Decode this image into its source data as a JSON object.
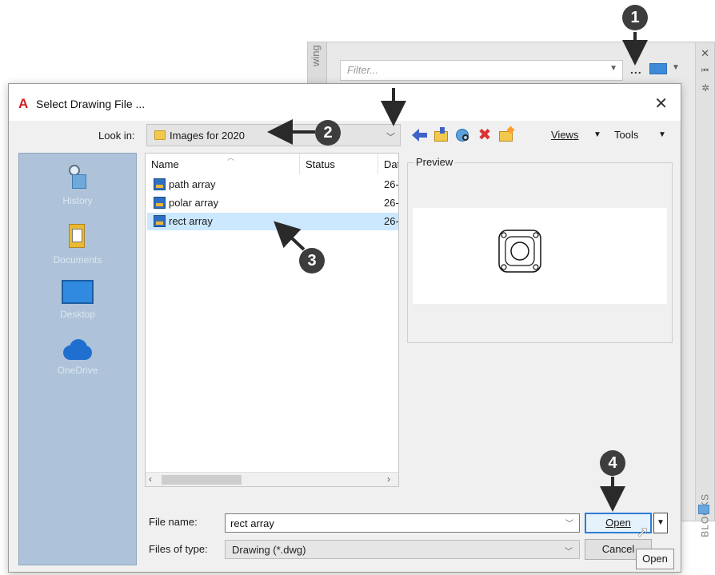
{
  "background_palette": {
    "side_label": "wing",
    "filter_placeholder": "Filter...",
    "ellipsis": "...",
    "blocks_label": "BLOCKS"
  },
  "dialog": {
    "title": "Select Drawing File ...",
    "close": "✕",
    "look_in_label": "Look in:",
    "look_in_value": "Images for 2020",
    "toolbar": {
      "views": "Views",
      "tools": "Tools"
    },
    "places": [
      {
        "label": "History",
        "icon": "history-icon"
      },
      {
        "label": "Documents",
        "icon": "documents-icon"
      },
      {
        "label": "Desktop",
        "icon": "desktop-icon"
      },
      {
        "label": "OneDrive",
        "icon": "onedrive-icon"
      }
    ],
    "file_list": {
      "columns": [
        "Name",
        "Status",
        "Dat"
      ],
      "rows": [
        {
          "name": "path array",
          "date": "26-",
          "selected": false
        },
        {
          "name": "polar array",
          "date": "26-",
          "selected": false
        },
        {
          "name": "rect array",
          "date": "26-",
          "selected": true
        }
      ]
    },
    "preview_label": "Preview",
    "file_name_label": "File name:",
    "file_name_value": "rect array",
    "files_of_type_label": "Files of type:",
    "files_of_type_value": "Drawing (*.dwg)",
    "open_button": "Open",
    "cancel_button": "Cancel",
    "tooltip": "Open"
  },
  "callouts": [
    "1",
    "2",
    "3",
    "4"
  ],
  "colors": {
    "accent": "#2f7bd6",
    "selection": "#cce8ff",
    "places_bar": "#aec3d9",
    "callout": "#3d3d3d"
  }
}
